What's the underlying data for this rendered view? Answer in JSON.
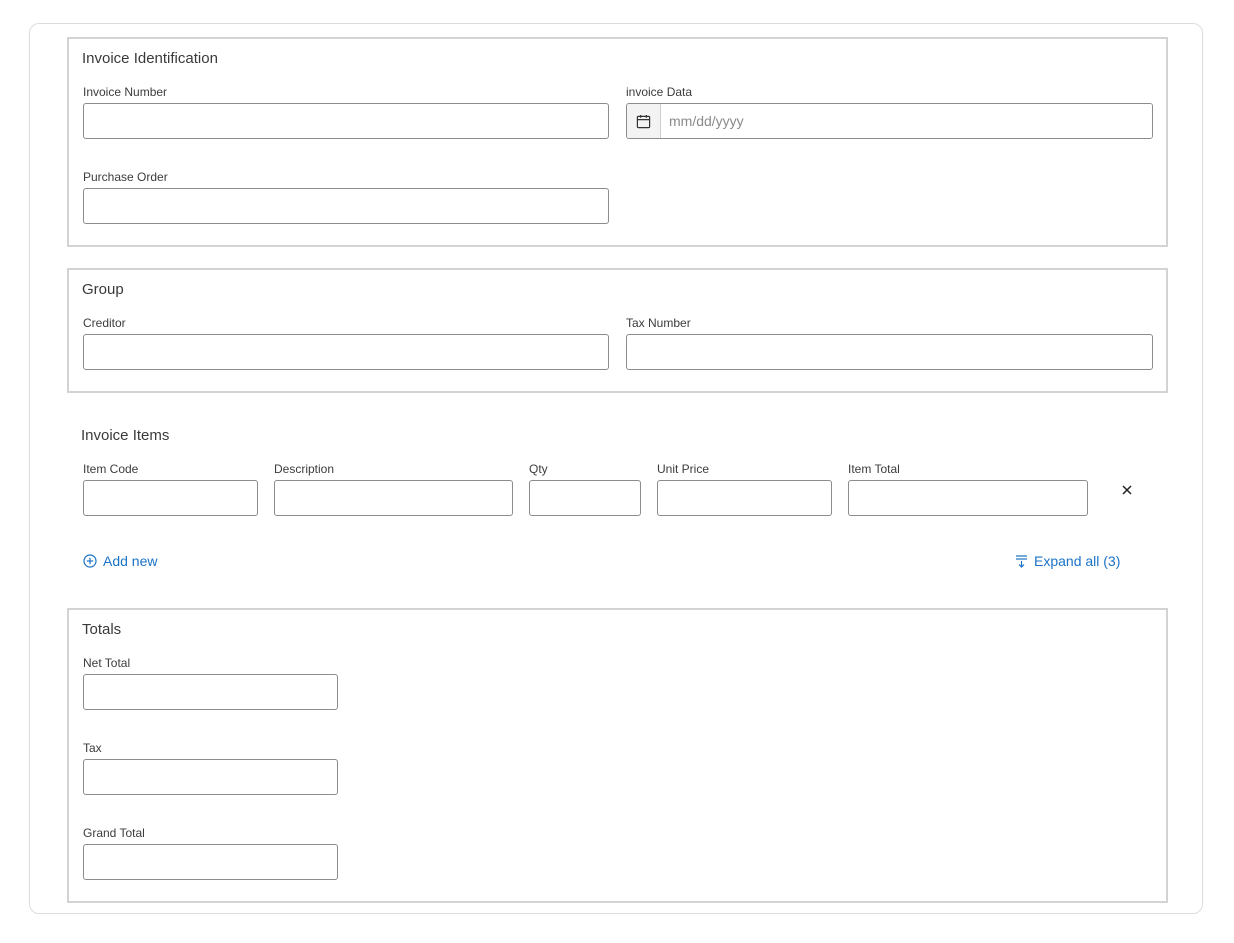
{
  "invoice_identification": {
    "title": "Invoice Identification",
    "invoice_number": {
      "label": "Invoice Number",
      "value": ""
    },
    "invoice_date": {
      "label": "invoice Data",
      "placeholder": "mm/dd/yyyy",
      "value": "",
      "icon": "calendar-icon"
    },
    "purchase_order": {
      "label": "Purchase Order",
      "value": ""
    }
  },
  "group": {
    "title": "Group",
    "creditor": {
      "label": "Creditor",
      "value": ""
    },
    "tax_number": {
      "label": "Tax Number",
      "value": ""
    }
  },
  "invoice_items": {
    "title": "Invoice Items",
    "columns": {
      "item_code": "Item Code",
      "description": "Description",
      "qty": "Qty",
      "unit_price": "Unit Price",
      "item_total": "Item Total"
    },
    "rows": [
      {
        "item_code": "",
        "description": "",
        "qty": "",
        "unit_price": "",
        "item_total": "",
        "remove_icon": "close-icon"
      }
    ],
    "add_new_label": "Add new",
    "expand_all_label": "Expand all (3)"
  },
  "totals": {
    "title": "Totals",
    "net_total": {
      "label": "Net Total",
      "value": ""
    },
    "tax": {
      "label": "Tax",
      "value": ""
    },
    "grand_total": {
      "label": "Grand Total",
      "value": ""
    }
  },
  "colors": {
    "link": "#1a73c7",
    "panel_border": "#d3d3d3",
    "input_border": "#8c8c8c"
  }
}
